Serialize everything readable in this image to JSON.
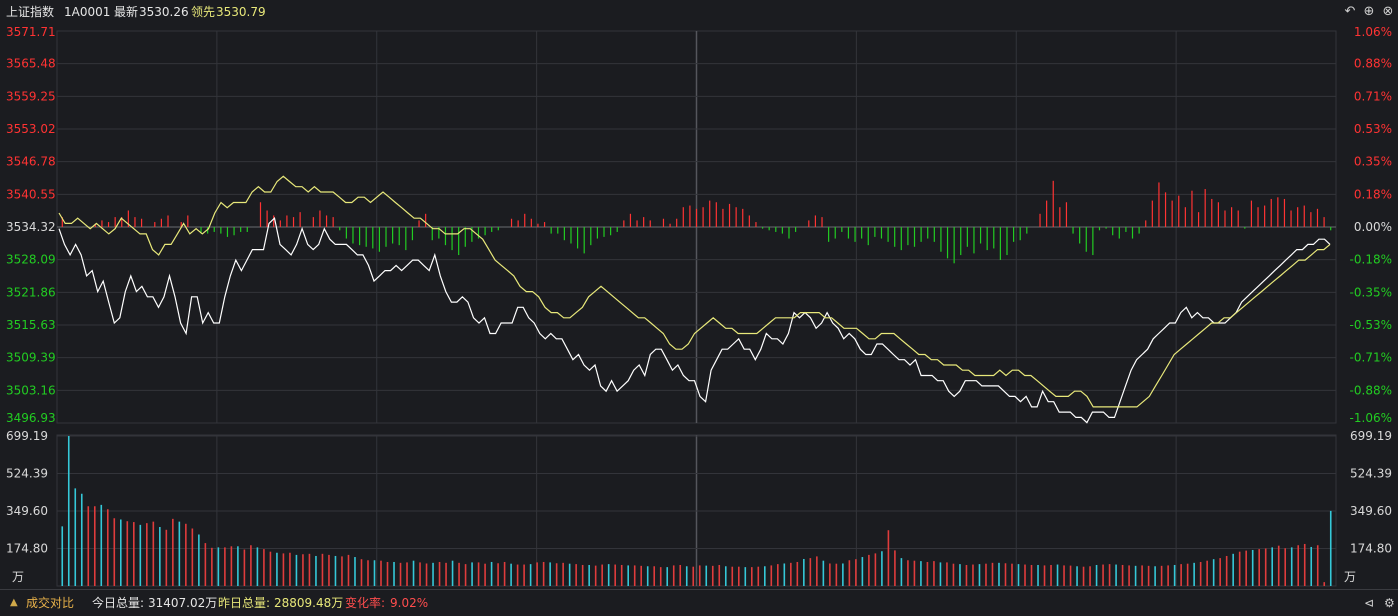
{
  "header": {
    "index_name": "上证指数",
    "index_code": "1A0001",
    "latest_label": "最新",
    "latest_value": "3530.26",
    "leading_label": "领先",
    "leading_value": "3530.79"
  },
  "colors": {
    "background": "#1b1c20",
    "up": "#ff3333",
    "down": "#22cc22",
    "white_line": "#ffffff",
    "yellow_line": "#e8e87a",
    "volume_cyan": "#35c8d8",
    "volume_red": "#e03c3c",
    "grid": "#33343a"
  },
  "chart_data": [
    {
      "type": "line",
      "name": "intraday-price",
      "y_ticks_left": [
        "3571.71",
        "3565.48",
        "3559.25",
        "3553.02",
        "3546.78",
        "3540.55",
        "3534.32",
        "3528.09",
        "3521.86",
        "3515.63",
        "3509.39",
        "3503.16",
        "3496.93"
      ],
      "y_ticks_right": [
        "1.06%",
        "0.88%",
        "0.71%",
        "0.53%",
        "0.35%",
        "0.18%",
        "0.00%",
        "-0.18%",
        "-0.35%",
        "-0.53%",
        "-0.71%",
        "-0.88%",
        "-1.06%"
      ],
      "ylim": [
        3496.93,
        3571.71
      ],
      "baseline": 3534.32,
      "series": [
        {
          "color": "white",
          "key": "white_line",
          "values": [
            3534,
            3531,
            3529,
            3531,
            3529,
            3525,
            3526,
            3522,
            3524,
            3520,
            3516,
            3517,
            3522,
            3525,
            3522,
            3523,
            3521,
            3521,
            3519,
            3521,
            3525,
            3521,
            3516,
            3514,
            3521,
            3521,
            3516,
            3518,
            3516,
            3516,
            3521,
            3525,
            3528,
            3526,
            3528,
            3530,
            3530,
            3530,
            3535,
            3536,
            3531,
            3530,
            3529,
            3531,
            3534,
            3531,
            3530,
            3531,
            3534,
            3532,
            3531,
            3531,
            3531,
            3530,
            3529,
            3529,
            3527,
            3524,
            3525,
            3526,
            3526,
            3527,
            3526,
            3527,
            3528,
            3528,
            3527,
            3526,
            3529,
            3525,
            3522,
            3520,
            3520,
            3521,
            3520,
            3517,
            3516,
            3517,
            3514,
            3514,
            3516,
            3516,
            3516,
            3519,
            3519,
            3517,
            3516,
            3514,
            3513,
            3514,
            3513,
            3513,
            3511,
            3509,
            3510,
            3508,
            3507,
            3508,
            3504,
            3503,
            3505,
            3503,
            3504,
            3505,
            3507,
            3508,
            3506,
            3510,
            3511,
            3511,
            3509,
            3507,
            3508,
            3506,
            3505,
            3505,
            3502,
            3501,
            3507,
            3509,
            3511,
            3511,
            3512,
            3513,
            3511,
            3511,
            3509,
            3511,
            3514,
            3513,
            3513,
            3512,
            3514,
            3518,
            3517,
            3518,
            3517,
            3515,
            3516,
            3518,
            3516,
            3515,
            3513,
            3514,
            3513,
            3511,
            3510,
            3510,
            3512,
            3512,
            3511,
            3510,
            3509,
            3509,
            3508,
            3509,
            3506,
            3506,
            3506,
            3505,
            3505,
            3503,
            3502,
            3503,
            3505,
            3505,
            3505,
            3504,
            3504,
            3504,
            3504,
            3503,
            3502,
            3502,
            3501,
            3502,
            3500,
            3500,
            3503,
            3501,
            3501,
            3499,
            3499,
            3499,
            3498,
            3498,
            3497,
            3499,
            3499,
            3499,
            3498,
            3498,
            3501,
            3504,
            3507,
            3509,
            3510,
            3511,
            3513,
            3514,
            3515,
            3516,
            3516,
            3518,
            3519,
            3517,
            3518,
            3517,
            3517,
            3516,
            3516,
            3516,
            3517,
            3518,
            3520,
            3521,
            3522,
            3523,
            3524,
            3525,
            3526,
            3527,
            3528,
            3529,
            3530,
            3530,
            3531,
            3531,
            3532,
            3532,
            3531
          ]
        },
        {
          "color": "yellow",
          "key": "yellow_line",
          "values": [
            3537,
            3535,
            3535,
            3536,
            3535,
            3534,
            3535,
            3534,
            3533,
            3534,
            3536,
            3535,
            3534,
            3533,
            3533,
            3530,
            3529,
            3531,
            3531,
            3533,
            3535,
            3533,
            3534,
            3533,
            3534,
            3537,
            3539,
            3538,
            3539,
            3539,
            3539,
            3541,
            3542,
            3541,
            3541,
            3543,
            3544,
            3543,
            3542,
            3542,
            3541,
            3542,
            3541,
            3541,
            3541,
            3540,
            3539,
            3539,
            3540,
            3540,
            3539,
            3540,
            3541,
            3540,
            3539,
            3538,
            3537,
            3536,
            3536,
            3535,
            3534,
            3534,
            3533,
            3533,
            3533,
            3534,
            3534,
            3533,
            3532,
            3530,
            3528,
            3527,
            3526,
            3525,
            3523,
            3522,
            3522,
            3521,
            3519,
            3518,
            3518,
            3517,
            3517,
            3518,
            3519,
            3521,
            3522,
            3523,
            3522,
            3521,
            3520,
            3519,
            3518,
            3517,
            3517,
            3516,
            3515,
            3514,
            3512,
            3511,
            3511,
            3512,
            3514,
            3515,
            3516,
            3517,
            3516,
            3515,
            3515,
            3514,
            3514,
            3514,
            3514,
            3515,
            3516,
            3517,
            3517,
            3517,
            3517,
            3518,
            3518,
            3518,
            3518,
            3517,
            3517,
            3516,
            3515,
            3515,
            3515,
            3514,
            3513,
            3513,
            3514,
            3514,
            3514,
            3513,
            3512,
            3511,
            3510,
            3510,
            3509,
            3509,
            3508,
            3508,
            3508,
            3507,
            3507,
            3506,
            3506,
            3506,
            3506,
            3507,
            3506,
            3507,
            3507,
            3506,
            3506,
            3505,
            3504,
            3503,
            3502,
            3502,
            3502,
            3503,
            3503,
            3502,
            3500,
            3500,
            3500,
            3500,
            3500,
            3500,
            3500,
            3500,
            3501,
            3502,
            3504,
            3506,
            3508,
            3510,
            3511,
            3512,
            3513,
            3514,
            3515,
            3516,
            3516,
            3517,
            3517,
            3518,
            3519,
            3520,
            3521,
            3522,
            3523,
            3524,
            3525,
            3526,
            3527,
            3528,
            3528,
            3529,
            3530,
            3530,
            3531
          ]
        }
      ]
    },
    {
      "type": "bar",
      "name": "buy-sell-strength",
      "baseline": "0.00%",
      "values_note": "",
      "values": [
        6,
        0,
        0,
        0,
        0,
        2,
        4,
        3,
        6,
        6,
        10,
        6,
        5,
        0,
        3,
        5,
        7,
        0,
        3,
        7,
        0,
        -4,
        -4,
        -3,
        -4,
        -6,
        -5,
        -3,
        -3,
        0,
        15,
        10,
        7,
        4,
        7,
        6,
        9,
        0,
        6,
        10,
        7,
        6,
        -2,
        -7,
        -10,
        -11,
        -12,
        -13,
        -15,
        -12,
        -10,
        -11,
        -14,
        -8,
        4,
        8,
        -8,
        -7,
        -11,
        -14,
        -17,
        -12,
        -9,
        -7,
        -5,
        -3,
        -2,
        0,
        5,
        4,
        8,
        5,
        2,
        3,
        -4,
        -4,
        -8,
        -10,
        -13,
        -16,
        -11,
        -7,
        -6,
        -5,
        -3,
        4,
        8,
        4,
        6,
        4,
        0,
        5,
        2,
        5,
        12,
        13,
        11,
        12,
        16,
        15,
        11,
        14,
        12,
        11,
        7,
        3,
        -1,
        -2,
        -3,
        -4,
        -7,
        -3,
        0,
        4,
        7,
        6,
        -9,
        -7,
        -3,
        -7,
        -9,
        -7,
        -11,
        -6,
        -7,
        -9,
        -12,
        -14,
        -11,
        -12,
        -9,
        -7,
        -9,
        -15,
        -19,
        -22,
        -17,
        -12,
        -16,
        -10,
        -14,
        -13,
        -20,
        -17,
        -9,
        -8,
        -4,
        0,
        8,
        16,
        28,
        12,
        15,
        -4,
        -10,
        -15,
        -17,
        -2,
        -1,
        -5,
        -7,
        -3,
        -7,
        -4,
        4,
        16,
        27,
        21,
        16,
        19,
        12,
        22,
        9,
        23,
        17,
        15,
        10,
        12,
        10,
        -1,
        16,
        12,
        13,
        17,
        18,
        17,
        10,
        12,
        13,
        9,
        11,
        6,
        -2
      ]
    },
    {
      "type": "bar",
      "name": "volume",
      "unit": "万",
      "y_ticks": [
        "699.19",
        "524.39",
        "349.60",
        "174.80"
      ],
      "ylim": [
        0,
        699.19
      ],
      "values": [
        278,
        699,
        455,
        430,
        372,
        372,
        378,
        358,
        316,
        310,
        302,
        298,
        285,
        293,
        300,
        275,
        262,
        313,
        300,
        290,
        268,
        240,
        200,
        178,
        180,
        180,
        185,
        185,
        170,
        190,
        180,
        172,
        160,
        155,
        152,
        155,
        145,
        148,
        150,
        140,
        150,
        145,
        140,
        138,
        145,
        135,
        125,
        120,
        120,
        118,
        112,
        112,
        108,
        110,
        118,
        110,
        105,
        108,
        112,
        108,
        118,
        108,
        102,
        110,
        110,
        104,
        112,
        106,
        112,
        104,
        100,
        100,
        102,
        110,
        112,
        110,
        106,
        108,
        104,
        102,
        98,
        98,
        95,
        100,
        102,
        100,
        98,
        96,
        96,
        94,
        92,
        92,
        88,
        88,
        96,
        98,
        92,
        90,
        96,
        95,
        94,
        98,
        92,
        90,
        90,
        88,
        88,
        90,
        92,
        96,
        102,
        105,
        108,
        112,
        126,
        130,
        138,
        118,
        105,
        104,
        105,
        120,
        125,
        135,
        145,
        152,
        162,
        260,
        166,
        130,
        120,
        118,
        116,
        112,
        116,
        110,
        110,
        104,
        102,
        98,
        100,
        102,
        104,
        108,
        108,
        106,
        104,
        102,
        100,
        98,
        98,
        96,
        98,
        100,
        96,
        95,
        92,
        90,
        92,
        98,
        100,
        102,
        100,
        98,
        96,
        94,
        96,
        94,
        92,
        94,
        96,
        98,
        102,
        104,
        108,
        112,
        118,
        125,
        130,
        140,
        150,
        160,
        165,
        168,
        172,
        175,
        180,
        188,
        176,
        180,
        190,
        196,
        182,
        190,
        18,
        350
      ]
    }
  ],
  "footer": {
    "volume_compare_label": "成交对比",
    "today_total_label": "今日总量:",
    "today_total_value": "31407.02万",
    "yesterday_total_label": "昨日总量:",
    "yesterday_total_value": "28809.48万",
    "change_rate_label": "变化率:",
    "change_rate_value": "9.02%"
  }
}
